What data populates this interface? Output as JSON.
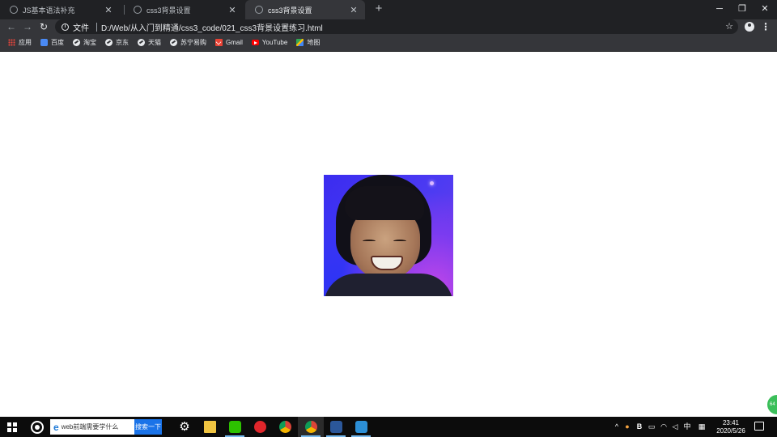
{
  "browser": {
    "tabs": [
      {
        "title": "JS基本语法补充",
        "active": false
      },
      {
        "title": "css3背景设置",
        "active": false
      },
      {
        "title": "css3背景设置",
        "active": true
      }
    ],
    "new_tab_icon": "+",
    "window_controls": {
      "minimize": "─",
      "maximize": "❐",
      "close": "✕"
    },
    "toolbar": {
      "back_icon": "←",
      "forward_icon": "→",
      "reload_icon": "↻",
      "scheme_label": "文件",
      "url": "D:/Web/从入门到精通/css3_code/021_css3背景设置练习.html",
      "star_icon": "☆",
      "menu_icon": "⋮"
    },
    "bookmarks": [
      {
        "label": "应用",
        "icon": "apps-icon"
      },
      {
        "label": "百度",
        "icon": "baidu-icon"
      },
      {
        "label": "淘宝",
        "icon": "globe-icon"
      },
      {
        "label": "京东",
        "icon": "globe-icon"
      },
      {
        "label": "天猫",
        "icon": "globe-icon"
      },
      {
        "label": "苏宁易购",
        "icon": "globe-icon"
      },
      {
        "label": "Gmail",
        "icon": "gmail-icon"
      },
      {
        "label": "YouTube",
        "icon": "youtube-icon"
      },
      {
        "label": "地图",
        "icon": "maps-icon"
      }
    ]
  },
  "page": {
    "image_description_icon": "portrait-photo",
    "side_badge": "64"
  },
  "taskbar": {
    "search_placeholder": "web前端需要学什么",
    "search_button": "搜索一下",
    "apps": [
      {
        "name": "settings",
        "color": "#ffffff"
      },
      {
        "name": "file-explorer",
        "color": "#f0c441"
      },
      {
        "name": "wechat",
        "color": "#2dc100"
      },
      {
        "name": "netease-music",
        "color": "#e0262b"
      },
      {
        "name": "chrome",
        "color": "#f4b400"
      },
      {
        "name": "chrome-active",
        "color": "#dddddd"
      },
      {
        "name": "word",
        "color": "#2b579a"
      },
      {
        "name": "vscode",
        "color": "#2c8fd6"
      }
    ],
    "tray": {
      "chevron": "^",
      "ime": "中",
      "time": "23:41",
      "date": "2020/5/26"
    }
  },
  "colors": {
    "tabstrip_bg": "#202124",
    "toolbar_bg": "#35363a",
    "taskbar_bg": "#0c0c0c"
  }
}
